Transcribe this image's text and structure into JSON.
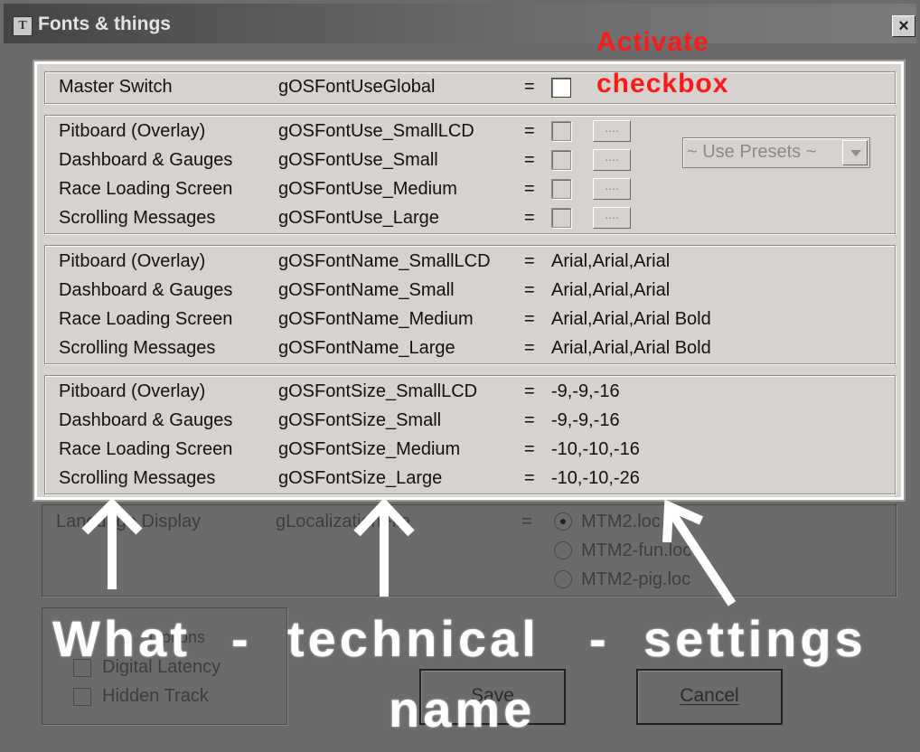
{
  "window": {
    "title": "Fonts & things",
    "icon_letter": "T",
    "close_glyph": "×"
  },
  "master": {
    "label": "Master Switch",
    "key": "gOSFontUseGlobal",
    "eq": "="
  },
  "use_rows": [
    {
      "label": "Pitboard (Overlay)",
      "key": "gOSFontUse_SmallLCD",
      "eq": "="
    },
    {
      "label": "Dashboard & Gauges",
      "key": "gOSFontUse_Small",
      "eq": "="
    },
    {
      "label": "Race Loading Screen",
      "key": "gOSFontUse_Medium",
      "eq": "="
    },
    {
      "label": "Scrolling Messages",
      "key": "gOSFontUse_Large",
      "eq": "="
    }
  ],
  "browse_button_label": "....",
  "presets": {
    "selected": "~ Use Presets ~"
  },
  "name_rows": [
    {
      "label": "Pitboard (Overlay)",
      "key": "gOSFontName_SmallLCD",
      "eq": "=",
      "value": "Arial,Arial,Arial"
    },
    {
      "label": "Dashboard & Gauges",
      "key": "gOSFontName_Small",
      "eq": "=",
      "value": "Arial,Arial,Arial"
    },
    {
      "label": "Race Loading Screen",
      "key": "gOSFontName_Medium",
      "eq": "=",
      "value": "Arial,Arial,Arial Bold"
    },
    {
      "label": "Scrolling Messages",
      "key": "gOSFontName_Large",
      "eq": "=",
      "value": "Arial,Arial,Arial Bold"
    }
  ],
  "size_rows": [
    {
      "label": "Pitboard (Overlay)",
      "key": "gOSFontSize_SmallLCD",
      "eq": "=",
      "value": "-9,-9,-16"
    },
    {
      "label": "Dashboard & Gauges",
      "key": "gOSFontSize_Small",
      "eq": "=",
      "value": "-9,-9,-16"
    },
    {
      "label": "Race Loading Screen",
      "key": "gOSFontSize_Medium",
      "eq": "=",
      "value": "-10,-10,-16"
    },
    {
      "label": "Scrolling Messages",
      "key": "gOSFontSize_Large",
      "eq": "=",
      "value": "-10,-10,-26"
    }
  ],
  "language": {
    "label": "Language Display",
    "key": "gLocalizationFile",
    "eq": "=",
    "options": [
      "MTM2.loc",
      "MTM2-fun.loc",
      "MTM2-pig.loc"
    ],
    "selected": "MTM2.loc"
  },
  "options": {
    "title": "Options",
    "items": [
      "Digital Latency",
      "Hidden Track"
    ]
  },
  "buttons": {
    "save": "Save",
    "cancel": "Cancel"
  },
  "annotations": {
    "activate_line1": "Activate",
    "activate_line2": "checkbox",
    "what": "What",
    "dash1": "-",
    "technical": "technical",
    "dash2": "-",
    "settings": "settings",
    "name": "name"
  },
  "colors": {
    "annotation_red": "#ff1a1a",
    "annotation_white": "#ffffff",
    "panel": "#d6d3ce"
  }
}
